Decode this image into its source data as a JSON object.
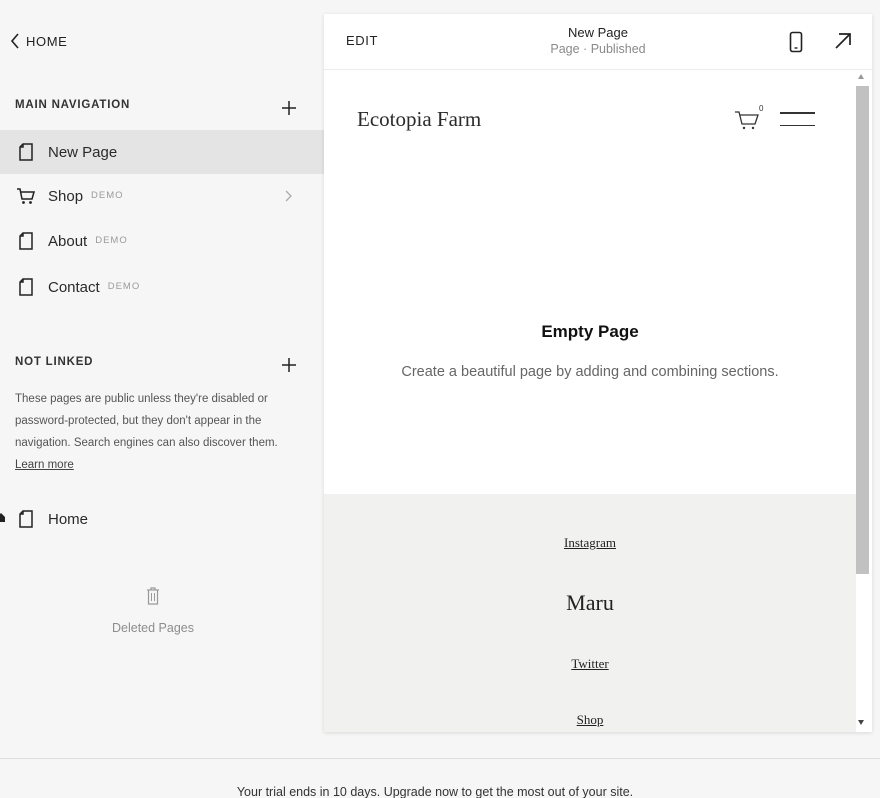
{
  "sidebar": {
    "back_label": "HOME",
    "main_nav": {
      "title": "MAIN NAVIGATION",
      "items": [
        {
          "label": "New Page",
          "badge": "",
          "icon": "page-icon",
          "selected": true
        },
        {
          "label": "Shop",
          "badge": "DEMO",
          "icon": "cart-icon",
          "selected": false
        },
        {
          "label": "About",
          "badge": "DEMO",
          "icon": "page-icon",
          "selected": false
        },
        {
          "label": "Contact",
          "badge": "DEMO",
          "icon": "page-icon",
          "selected": false
        }
      ]
    },
    "not_linked": {
      "title": "NOT LINKED",
      "note": "These pages are public unless they're disabled or password-protected, but they don't appear in the navigation. Search engines can also discover them.",
      "learn_more": "Learn more",
      "items": [
        {
          "label": "Home",
          "icon": "page-icon"
        }
      ]
    },
    "deleted_label": "Deleted Pages"
  },
  "preview": {
    "edit_label": "EDIT",
    "page_title": "New Page",
    "page_status": "Page · Published",
    "site": {
      "title": "Ecotopia Farm",
      "cart_count": "0",
      "empty_title": "Empty Page",
      "empty_subtitle": "Create a beautiful page by adding and combining sections.",
      "footer": {
        "link_instagram": "Instagram",
        "brand": "Maru",
        "link_twitter": "Twitter",
        "link_shop": "Shop"
      }
    }
  },
  "trial": {
    "message": "Your trial ends in 10 days. Upgrade now to get the most out of your site."
  },
  "colors": {
    "sidebar_bg": "#f6f6f6",
    "selected_bg": "#e4e4e4",
    "footer_bg": "#f1f1ef",
    "scrollbar": "#c1c1c1"
  }
}
